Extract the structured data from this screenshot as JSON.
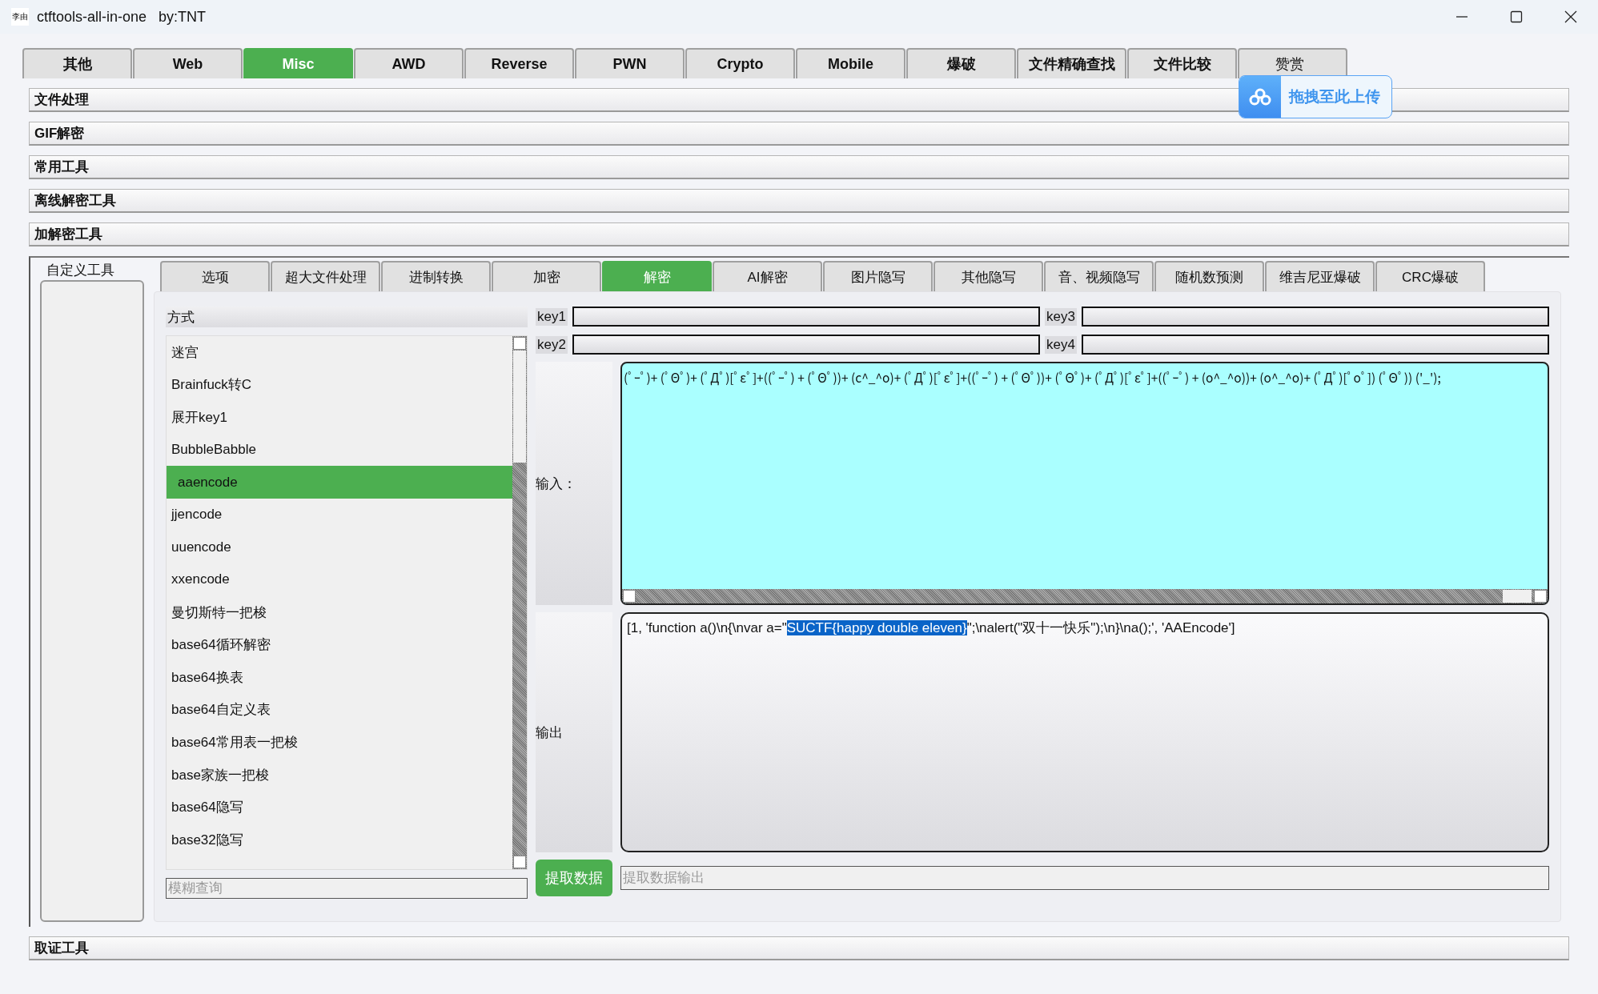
{
  "window": {
    "app_icon": "李由",
    "title": "ctftools-all-in-one   by:TNT"
  },
  "main_tabs": [
    {
      "label": "其他",
      "selected": false
    },
    {
      "label": "Web",
      "selected": false
    },
    {
      "label": "Misc",
      "selected": true
    },
    {
      "label": "AWD",
      "selected": false
    },
    {
      "label": "Reverse",
      "selected": false
    },
    {
      "label": "PWN",
      "selected": false
    },
    {
      "label": "Crypto",
      "selected": false
    },
    {
      "label": "Mobile",
      "selected": false
    },
    {
      "label": "爆破",
      "selected": false
    },
    {
      "label": "文件精确查找",
      "selected": false
    },
    {
      "label": "文件比较",
      "selected": false
    },
    {
      "label": "赞赏",
      "selected": false
    }
  ],
  "upload_popup": {
    "label": "拖拽至此上传"
  },
  "sections": [
    "文件处理",
    "GIF解密",
    "常用工具",
    "离线解密工具",
    "加解密工具"
  ],
  "custom_tools": {
    "label": "自定义工具"
  },
  "sub_tabs": [
    {
      "label": "选项",
      "selected": false
    },
    {
      "label": "超大文件处理",
      "selected": false
    },
    {
      "label": "进制转换",
      "selected": false
    },
    {
      "label": "加密",
      "selected": false
    },
    {
      "label": "解密",
      "selected": true
    },
    {
      "label": "AI解密",
      "selected": false
    },
    {
      "label": "图片隐写",
      "selected": false
    },
    {
      "label": "其他隐写",
      "selected": false
    },
    {
      "label": "音、视频隐写",
      "selected": false
    },
    {
      "label": "随机数预测",
      "selected": false
    },
    {
      "label": "维吉尼亚爆破",
      "selected": false
    },
    {
      "label": "CRC爆破",
      "selected": false
    }
  ],
  "method_list": {
    "header": "方式",
    "items": [
      {
        "label": "迷宫",
        "selected": false
      },
      {
        "label": "Brainfuck转C",
        "selected": false
      },
      {
        "label": "展开key1",
        "selected": false
      },
      {
        "label": "BubbleBabble",
        "selected": false
      },
      {
        "label": "aaencode",
        "selected": true
      },
      {
        "label": "jjencode",
        "selected": false
      },
      {
        "label": "uuencode",
        "selected": false
      },
      {
        "label": "xxencode",
        "selected": false
      },
      {
        "label": "曼切斯特一把梭",
        "selected": false
      },
      {
        "label": "base64循环解密",
        "selected": false
      },
      {
        "label": "base64换表",
        "selected": false
      },
      {
        "label": "base64自定义表",
        "selected": false
      },
      {
        "label": "base64常用表一把梭",
        "selected": false
      },
      {
        "label": "base家族一把梭",
        "selected": false
      },
      {
        "label": "base64隐写",
        "selected": false
      },
      {
        "label": "base32隐写",
        "selected": false
      }
    ],
    "search": {
      "placeholder": "模糊查询"
    }
  },
  "keys": [
    {
      "label": "key1"
    },
    {
      "label": "key3"
    },
    {
      "label": "key2"
    },
    {
      "label": "key4"
    }
  ],
  "input": {
    "label": "输入：",
    "value": "(ﾟｰﾟ)+ (ﾟΘﾟ)+ (ﾟДﾟ)[ﾟεﾟ]+((ﾟｰﾟ) + (ﾟΘﾟ))+ (c^_^o)+ (ﾟДﾟ)[ﾟεﾟ]+((ﾟｰﾟ) + (ﾟΘﾟ))+ (ﾟΘﾟ)+ (ﾟДﾟ)[ﾟεﾟ]+((ﾟｰﾟ) + (o^_^o))+ (o^_^o)+ (ﾟДﾟ)[ﾟoﾟ]) (ﾟΘﾟ)) ('_');"
  },
  "output": {
    "label": "输出",
    "segments": [
      {
        "text": "[1, 'function a()\\n{\\nvar a=\"",
        "selected": false
      },
      {
        "text": "SUCTF{happy double eleven}",
        "selected": true
      },
      {
        "text": "\";\\nalert(\"双十一快乐\");\\n}\\na();', 'AAEncode']",
        "selected": false
      }
    ]
  },
  "extract": {
    "button": "提取数据",
    "placeholder": "提取数据输出"
  },
  "bottom_sections": [
    "取证工具"
  ]
}
